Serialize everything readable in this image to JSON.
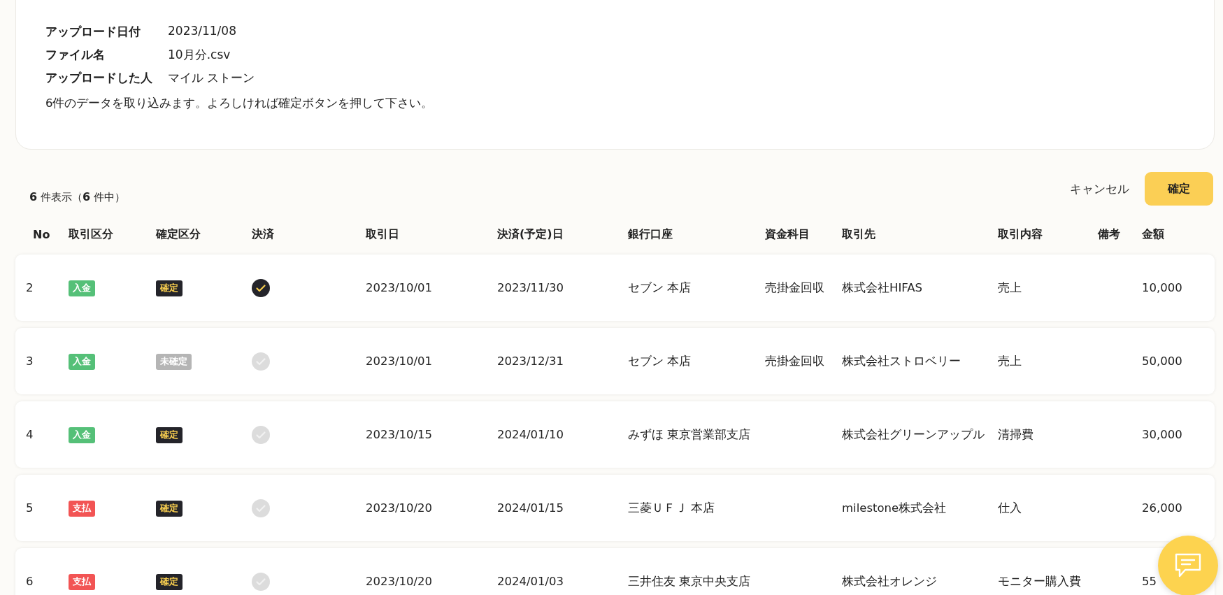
{
  "upload_info": {
    "fields": [
      {
        "label": "アップロード日付",
        "value": "2023/11/08"
      },
      {
        "label": "ファイル名",
        "value": "10月分.csv"
      },
      {
        "label": "アップロードした人",
        "value": "マイル ストーン"
      }
    ],
    "message": "6件のデータを取り込みます。よろしければ確定ボタンを押して下さい。"
  },
  "summary": {
    "shown": "6",
    "shown_unit": "件表示（",
    "total": "6",
    "total_unit": "件中）"
  },
  "actions": {
    "cancel": "キャンセル",
    "confirm": "確定"
  },
  "table": {
    "columns": [
      "No",
      "取引区分",
      "確定区分",
      "決済",
      "取引日",
      "決済(予定)日",
      "銀行口座",
      "資金科目",
      "取引先",
      "取引内容",
      "備考",
      "金額"
    ],
    "rows": [
      {
        "no": "2",
        "type": {
          "kind": "deposit",
          "label": "入金"
        },
        "status": {
          "confirmed": true,
          "label": "確定"
        },
        "settled": true,
        "date": "2023/10/01",
        "due": "2023/11/30",
        "bank": "セブン 本店",
        "subject": "売掛金回収",
        "partner": "株式会社HIFAS",
        "content": "売上",
        "amount": "10,000"
      },
      {
        "no": "3",
        "type": {
          "kind": "deposit",
          "label": "入金"
        },
        "status": {
          "confirmed": false,
          "label": "未確定"
        },
        "settled": false,
        "date": "2023/10/01",
        "due": "2023/12/31",
        "bank": "セブン 本店",
        "subject": "売掛金回収",
        "partner": "株式会社ストロベリー",
        "content": "売上",
        "amount": "50,000"
      },
      {
        "no": "4",
        "type": {
          "kind": "deposit",
          "label": "入金"
        },
        "status": {
          "confirmed": true,
          "label": "確定"
        },
        "settled": false,
        "date": "2023/10/15",
        "due": "2024/01/10",
        "bank": "みずほ 東京営業部支店",
        "partner": "株式会社グリーンアップル",
        "content": "清掃費",
        "amount": "30,000"
      },
      {
        "no": "5",
        "type": {
          "kind": "payment",
          "label": "支払"
        },
        "status": {
          "confirmed": true,
          "label": "確定"
        },
        "settled": false,
        "date": "2023/10/20",
        "due": "2024/01/15",
        "bank": "三菱ＵＦＪ 本店",
        "partner": "milestone株式会社",
        "content": "仕入",
        "amount": "26,000"
      },
      {
        "no": "6",
        "type": {
          "kind": "payment",
          "label": "支払"
        },
        "status": {
          "confirmed": true,
          "label": "確定"
        },
        "settled": false,
        "date": "2023/10/20",
        "due": "2024/01/03",
        "bank": "三井住友 東京中央支店",
        "partner": "株式会社オレンジ",
        "content": "モニター購入費",
        "amount": "55"
      }
    ]
  }
}
